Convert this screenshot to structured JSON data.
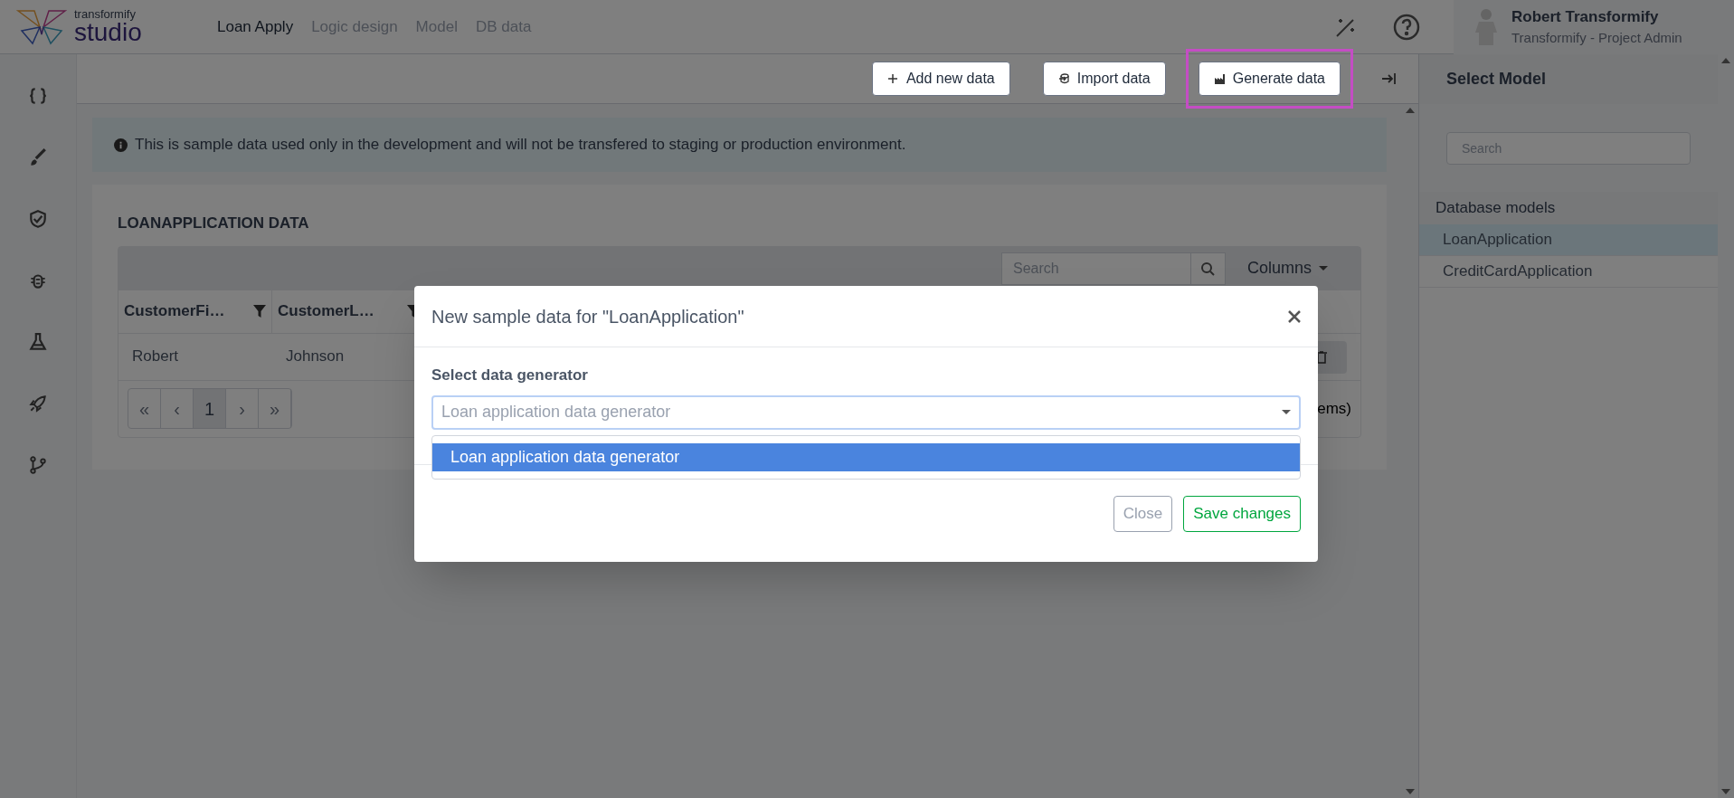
{
  "app": {
    "logo_top": "transformify",
    "logo_bottom": "studio"
  },
  "nav": [
    {
      "label": "Loan Apply",
      "selected": true
    },
    {
      "label": "Logic design",
      "selected": false
    },
    {
      "label": "Model",
      "selected": false
    },
    {
      "label": "DB data",
      "selected": false
    }
  ],
  "user": {
    "name": "Robert Transformify",
    "role": "Transformify - Project Admin"
  },
  "toolbar": {
    "buttons": [
      {
        "label": "Add new data",
        "highlighted": false
      },
      {
        "label": "Import data",
        "highlighted": false
      },
      {
        "label": "Generate data",
        "highlighted": true
      }
    ]
  },
  "notice": "This is sample data used only in the development and will not be transfered to staging or production environment.",
  "table": {
    "title": "LOANAPPLICATION DATA",
    "search_placeholder": "Search",
    "columns_button": "Columns",
    "columns": [
      "CustomerFi…",
      "CustomerL…"
    ],
    "rows": [
      [
        "Robert",
        "Johnson"
      ]
    ],
    "pagination": [
      {
        "label": "«",
        "disabled": true,
        "selected": false
      },
      {
        "label": "‹",
        "disabled": true,
        "selected": false
      },
      {
        "label": "1",
        "disabled": false,
        "selected": true
      },
      {
        "label": "›",
        "disabled": true,
        "selected": false
      },
      {
        "label": "»",
        "disabled": true,
        "selected": false
      }
    ],
    "summary": "ems)"
  },
  "right_panel": {
    "title": "Select Model",
    "search_placeholder": "Search",
    "group": "Database models",
    "items": [
      {
        "label": "LoanApplication",
        "selected": true
      },
      {
        "label": "CreditCardApplication",
        "selected": false
      }
    ]
  },
  "modal": {
    "title": "New sample data for \"LoanApplication\"",
    "field_label": "Select data generator",
    "select_value": "Loan application data generator",
    "options": [
      {
        "label": "Loan application data generator",
        "selected": true
      }
    ],
    "buttons": [
      {
        "label": "Close",
        "kind": "secondary"
      },
      {
        "label": "Save changes",
        "kind": "primary"
      }
    ]
  }
}
